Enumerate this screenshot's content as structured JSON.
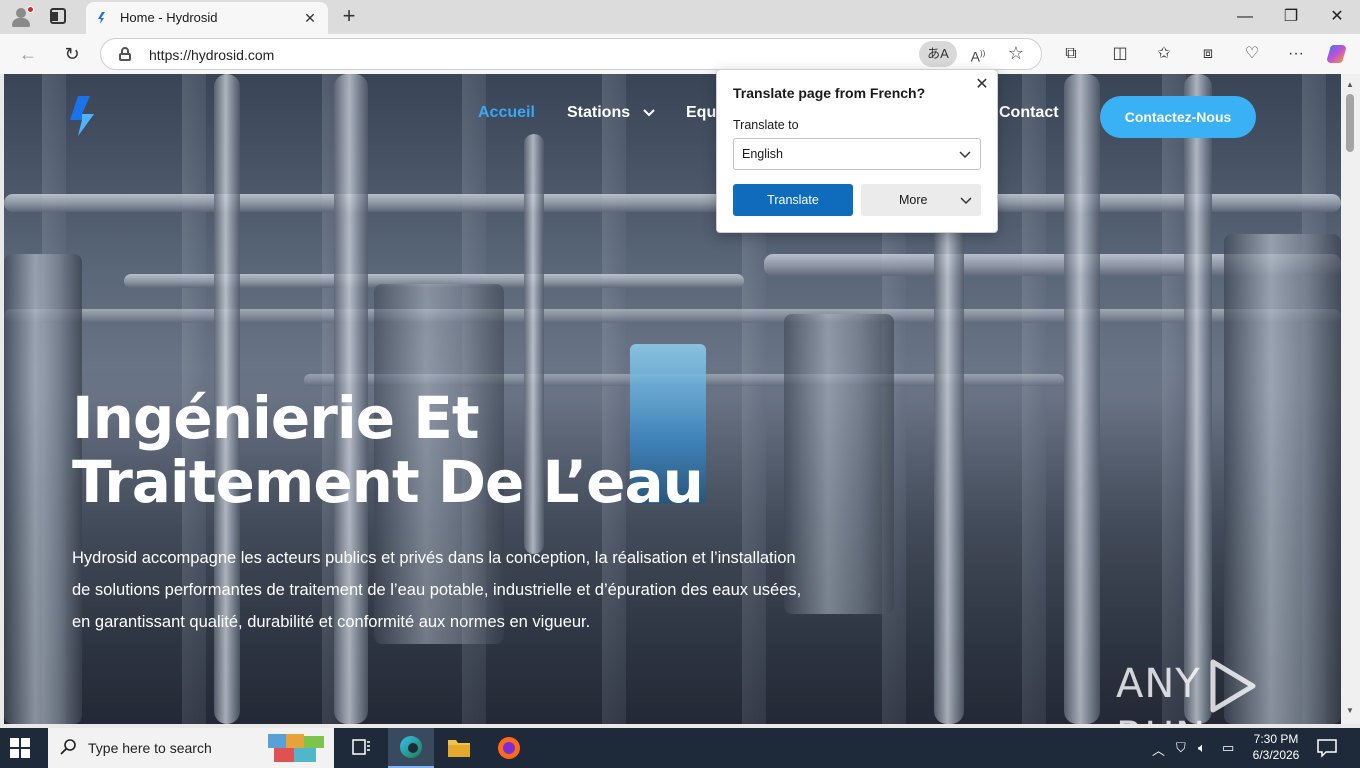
{
  "browser": {
    "tab_title": "Home - Hydrosid",
    "url": "https://hydrosid.com"
  },
  "site": {
    "nav": [
      {
        "label": "Accueil"
      },
      {
        "label": "Stations"
      },
      {
        "label": "Equ"
      },
      {
        "label": "Contact"
      }
    ],
    "cta_label": "Contactez-Nous",
    "hero_title_line1": "Ingénierie Et",
    "hero_title_line2": "Traitement De L’eau",
    "hero_text": "Hydrosid accompagne les acteurs publics et privés dans la conception, la réalisation et l’installation de solutions performantes de traitement de l’eau potable, industrielle et d’épuration des eaux usées, en garantissant qualité, durabilité et conformité aux normes en vigueur.",
    "accent_color": "#3ab0f5"
  },
  "translate_popup": {
    "title": "Translate page from French?",
    "label": "Translate to",
    "selected_language": "English",
    "translate_button": "Translate",
    "more_button": "More"
  },
  "watermark": {
    "left": "ANY",
    "right": "RUN"
  },
  "taskbar": {
    "search_placeholder": "Type here to search",
    "time": "7:30 PM",
    "date": "6/3/2026"
  }
}
